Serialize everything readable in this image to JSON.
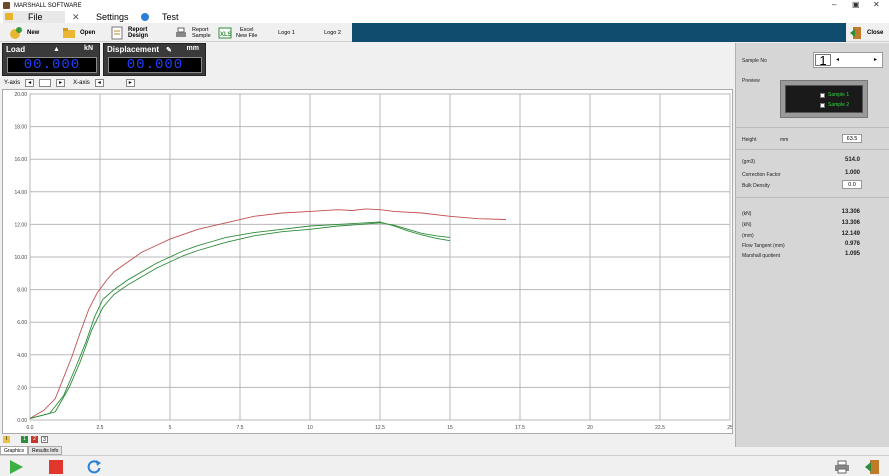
{
  "window": {
    "title": "MARSHALL SOFTWARE",
    "minimize_glyph": "–",
    "maximize_glyph": "▣",
    "close_glyph": "✕"
  },
  "menu": {
    "file": "File",
    "settings": "Settings",
    "test": "Test"
  },
  "toolbar": {
    "new": "New",
    "open": "Open",
    "report_design": "Report Design",
    "report_sample_line1": "Report",
    "report_sample_line2": "Sample",
    "excel_line1": "Excel",
    "excel_line2": "New File",
    "logo1": "Logo 1",
    "logo2": "Logo 2",
    "close": "Close"
  },
  "readouts": {
    "load": {
      "label": "Load",
      "unit": "kN",
      "value": "00.000"
    },
    "displacement": {
      "label": "Displacement",
      "unit": "mm",
      "value": "00.000"
    }
  },
  "view_controls": {
    "y_label": "Y-axis",
    "x_label": "X-axis"
  },
  "right_panel": {
    "sample_label": "Sample No",
    "sample_number": "1",
    "preview_label": "Preview",
    "preview_items": [
      "Sample 1",
      "Sample 2"
    ],
    "height_label": "Height",
    "height_unit": "mm",
    "height_value": "63.5",
    "rows1": [
      {
        "label": "(gm3)",
        "value": "514.0"
      },
      {
        "label": "Correction Factor",
        "value": "1.000"
      },
      {
        "label": "Bulk Density",
        "value": "0.0"
      }
    ],
    "rows2": [
      {
        "label": "(kN)",
        "value": "13.306"
      },
      {
        "label": "(kN)",
        "value": "13.306"
      },
      {
        "label": "(mm)",
        "value": "12.149"
      },
      {
        "label": "Flow Tangent (mm)",
        "value": "0.976"
      },
      {
        "label": "Marshall quotient",
        "value": "1.095"
      }
    ]
  },
  "tabs": [
    "Graphics",
    "Results Info"
  ],
  "bottom_controls": [
    "I",
    "1",
    "2",
    "3"
  ],
  "colors": {
    "series_red": "#c0504d",
    "series_green": "#2e8b3a",
    "toolbar_strip": "#0f4c6e",
    "readout_digits": "#1e3fff"
  },
  "chart_data": {
    "type": "line",
    "xlim": [
      0,
      25
    ],
    "ylim": [
      0,
      20
    ],
    "x_ticks": [
      "0.0",
      "2.5",
      "5",
      "7.5",
      "10",
      "12.5",
      "15",
      "17.5",
      "20",
      "22.5",
      "25"
    ],
    "y_ticks": [
      "0.00",
      "2.00",
      "4.00",
      "6.00",
      "8.00",
      "10.00",
      "12.00",
      "14.00",
      "16.00",
      "18.00",
      "20.00"
    ],
    "grid": true,
    "series": [
      {
        "color": "#c0504d",
        "x": [
          0,
          0.5,
          0.9,
          1.2,
          1.5,
          1.8,
          2.1,
          2.4,
          2.7,
          3.0,
          3.5,
          4.0,
          4.5,
          5.0,
          5.5,
          6.0,
          7.0,
          8.0,
          9.0,
          10.0,
          11.0,
          11.5,
          12.0,
          12.5,
          13.0,
          14.0,
          15.0,
          16.0,
          17.0
        ],
        "y": [
          0.1,
          0.6,
          1.3,
          2.6,
          3.9,
          5.4,
          6.8,
          7.8,
          8.5,
          9.1,
          9.7,
          10.3,
          10.7,
          11.1,
          11.4,
          11.7,
          12.1,
          12.5,
          12.7,
          12.8,
          12.9,
          12.85,
          12.95,
          12.9,
          12.8,
          12.7,
          12.5,
          12.35,
          12.3
        ]
      },
      {
        "color": "#2e8b3a",
        "x": [
          0,
          0.7,
          1.2,
          1.6,
          2.0,
          2.3,
          2.6,
          3.0,
          3.5,
          4.0,
          4.5,
          5.0,
          5.5,
          6.0,
          6.5,
          7.0,
          8.0,
          9.0,
          10.0,
          11.0,
          12.0,
          12.5,
          13.0,
          13.5,
          14.0,
          14.5,
          15.0
        ],
        "y": [
          0.1,
          0.4,
          1.5,
          3.1,
          4.8,
          6.3,
          7.4,
          8.0,
          8.6,
          9.1,
          9.6,
          10.0,
          10.4,
          10.7,
          10.95,
          11.2,
          11.5,
          11.7,
          11.9,
          12.0,
          12.1,
          12.15,
          11.9,
          11.6,
          11.35,
          11.15,
          11.0
        ]
      },
      {
        "color": "#2e8b3a",
        "x": [
          0,
          0.9,
          1.4,
          1.8,
          2.2,
          2.6,
          3.0,
          3.5,
          4.0,
          4.5,
          5.0,
          5.5,
          6.0,
          7.0,
          8.0,
          9.0,
          10.0,
          11.0,
          11.8,
          12.5,
          13.0,
          13.5,
          14.0,
          14.5,
          15.0
        ],
        "y": [
          0.1,
          0.5,
          2.0,
          3.6,
          5.5,
          6.9,
          7.7,
          8.3,
          8.8,
          9.3,
          9.7,
          10.1,
          10.4,
          10.9,
          11.3,
          11.55,
          11.7,
          11.9,
          12.0,
          12.1,
          11.95,
          11.7,
          11.45,
          11.3,
          11.2
        ]
      }
    ]
  }
}
